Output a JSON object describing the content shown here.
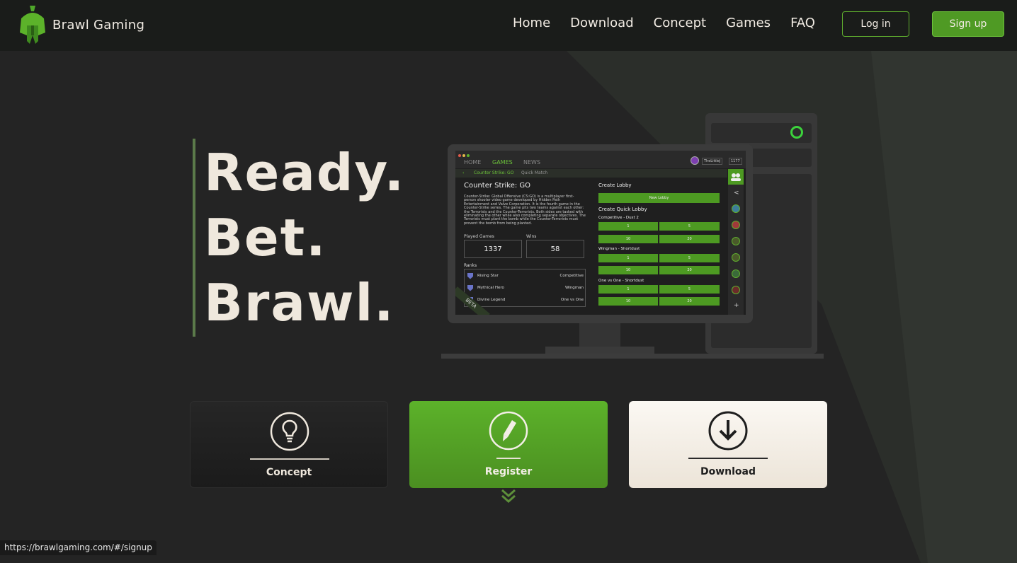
{
  "header": {
    "brand_name": "Brawl Gaming",
    "nav": [
      "Home",
      "Download",
      "Concept",
      "Games",
      "FAQ"
    ],
    "login_label": "Log in",
    "signup_label": "Sign up"
  },
  "hero": {
    "lines": [
      "Ready.",
      "Bet.",
      "Brawl."
    ]
  },
  "screen": {
    "tabs": [
      "HOME",
      "GAMES",
      "NEWS"
    ],
    "user": "TheLittleJ",
    "balance": "1177",
    "breadcrumb_current": "Counter Strike: GO",
    "breadcrumb_next": "Quick Match",
    "game_title": "Counter Strike: GO",
    "description": "Counter-Strike: Global Offensive (CS:GO) is a multiplayer first-person shooter video game developed by Hidden Path Entertainment and Valve Corporation. It is the fourth game in the Counter-Strike series. The game pits two teams against each other: the Terrorists and the Counter-Terrorists. Both sides are tasked with eliminating the other while also completing separate objectives. The Terrorists must plant the bomb while the Counter-Terrorists must prevent the bomb from being planted.",
    "played_label": "Played Games",
    "played_value": "1337",
    "wins_label": "Wins",
    "wins_value": "58",
    "ranks_label": "Ranks",
    "ranks": [
      {
        "name": "Rising Star",
        "mode": "Competitive"
      },
      {
        "name": "Mythical Hero",
        "mode": "Wingman"
      },
      {
        "name": "Divine Legend",
        "mode": "One vs One"
      }
    ],
    "beta": "BETA",
    "create_lobby": "Create Lobby",
    "new_lobby": "New Lobby",
    "create_quick": "Create Quick Lobby",
    "quick_groups": [
      {
        "name": "Competitive - Dust 2",
        "bets": [
          "1",
          "5",
          "10",
          "20"
        ]
      },
      {
        "name": "Wingman - Shortdust",
        "bets": [
          "1",
          "5",
          "10",
          "20"
        ]
      },
      {
        "name": "One vs One - Shortdust",
        "bets": [
          "1",
          "5",
          "10",
          "20"
        ]
      }
    ],
    "sidebar_add": "+",
    "sidebar_back": "<"
  },
  "cards": {
    "concept": "Concept",
    "register": "Register",
    "download": "Download"
  },
  "status_url": "https://brawlgaming.com/#/signup",
  "colors": {
    "accent": "#5cb22a",
    "background": "#242424",
    "cream": "#efe8dd"
  }
}
